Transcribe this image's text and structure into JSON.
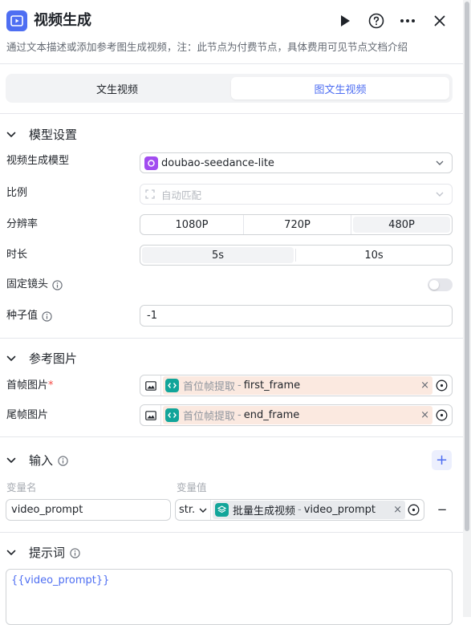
{
  "header": {
    "title": "视频生成",
    "description": "通过文本描述或添加参考图生成视频，注：此节点为付费节点，具体费用可见节点文档介绍",
    "icons": [
      "video-icon",
      "run-icon",
      "help-icon",
      "more-icon",
      "close-icon"
    ]
  },
  "tabs": [
    {
      "label": "文生视频",
      "active": false
    },
    {
      "label": "图文生视频",
      "active": true
    }
  ],
  "model_settings": {
    "section_title": "模型设置",
    "model_label": "视频生成模型",
    "model_value": "doubao-seedance-lite",
    "ratio_label": "比例",
    "ratio_value": "自动匹配",
    "resolution_label": "分辨率",
    "resolution_options": [
      "1080P",
      "720P",
      "480P"
    ],
    "resolution_selected": "480P",
    "duration_label": "时长",
    "duration_options": [
      "5s",
      "10s"
    ],
    "duration_selected": "5s",
    "fixed_camera_label": "固定镜头",
    "fixed_camera_on": false,
    "seed_label": "种子值",
    "seed_value": "-1"
  },
  "reference_images": {
    "section_title": "参考图片",
    "first_label": "首帧图片",
    "required_mark": "*",
    "first_source": "首位帧提取",
    "first_var": "first_frame",
    "last_label": "尾帧图片",
    "last_source": "首位帧提取",
    "last_var": "end_frame",
    "separator": "-",
    "remove": "×"
  },
  "inputs": {
    "section_title": "输入",
    "add_label": "+",
    "col_name": "变量名",
    "col_value": "变量值",
    "row_name": "video_prompt",
    "row_type": "str.",
    "row_source": "批量生成视频",
    "row_var": "video_prompt",
    "remove": "×",
    "delete_row": "−"
  },
  "prompt": {
    "section_title": "提示词",
    "value": "{{video_prompt}}"
  },
  "colors": {
    "accent": "#4e6ef2",
    "chip_bg": "#fbe9e0",
    "teal": "#12a59a",
    "model_icon": "#a24cf0",
    "prompt_text": "#4e6ef2"
  }
}
